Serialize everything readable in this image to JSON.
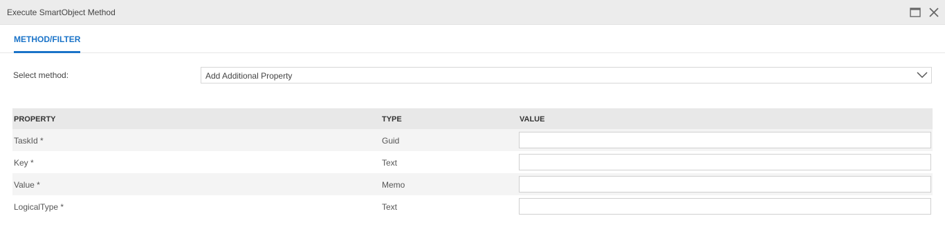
{
  "window": {
    "title": "Execute SmartObject Method",
    "maximize_icon": "maximize-icon",
    "close_icon": "close-icon"
  },
  "tabs": [
    {
      "label": "METHOD/FILTER",
      "active": true
    }
  ],
  "method": {
    "label": "Select method:",
    "selected": "Add Additional Property",
    "dropdown_icon": "chevron-down-icon"
  },
  "table": {
    "headers": {
      "property": "PROPERTY",
      "type": "TYPE",
      "value": "VALUE"
    },
    "rows": [
      {
        "property": "TaskId *",
        "type": "Guid",
        "value": ""
      },
      {
        "property": "Key *",
        "type": "Text",
        "value": ""
      },
      {
        "property": "Value *",
        "type": "Memo",
        "value": ""
      },
      {
        "property": "LogicalType *",
        "type": "Text",
        "value": ""
      }
    ]
  },
  "colors": {
    "accent": "#1a73c8",
    "titlebar_bg": "#ececec",
    "header_bg": "#e8e8e8",
    "alt_row_bg": "#f4f4f4"
  }
}
